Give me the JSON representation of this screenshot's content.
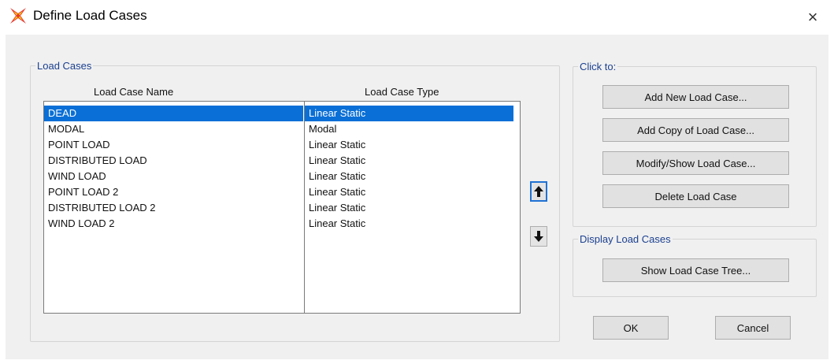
{
  "window": {
    "title": "Define Load Cases",
    "close_symbol": "×",
    "icon": "sap2000-app-icon"
  },
  "load_cases_group": {
    "legend": "Load Cases",
    "col_name_header": "Load Case Name",
    "col_type_header": "Load Case Type",
    "rows": [
      {
        "name": "DEAD",
        "type": "Linear Static",
        "selected": true
      },
      {
        "name": "MODAL",
        "type": "Modal",
        "selected": false
      },
      {
        "name": "POINT LOAD",
        "type": "Linear Static",
        "selected": false
      },
      {
        "name": "DISTRIBUTED LOAD",
        "type": "Linear Static",
        "selected": false
      },
      {
        "name": "WIND LOAD",
        "type": "Linear Static",
        "selected": false
      },
      {
        "name": "POINT LOAD 2",
        "type": "Linear Static",
        "selected": false
      },
      {
        "name": "DISTRIBUTED LOAD 2",
        "type": "Linear Static",
        "selected": false
      },
      {
        "name": "WIND LOAD 2",
        "type": "Linear Static",
        "selected": false
      }
    ],
    "move_up_icon": "arrow-up-icon",
    "move_down_icon": "arrow-down-icon"
  },
  "click_to_group": {
    "legend": "Click to:",
    "add_new": "Add New Load Case...",
    "add_copy": "Add Copy of Load Case...",
    "modify_show": "Modify/Show Load Case...",
    "delete": "Delete Load Case"
  },
  "display_group": {
    "legend": "Display Load Cases",
    "show_tree": "Show Load Case Tree..."
  },
  "footer": {
    "ok": "OK",
    "cancel": "Cancel"
  },
  "colors": {
    "selection": "#0a6fd6",
    "legend_text": "#1a3f8f",
    "dialog_bg": "#f0f0f0",
    "focus_border": "#1f72d4"
  }
}
